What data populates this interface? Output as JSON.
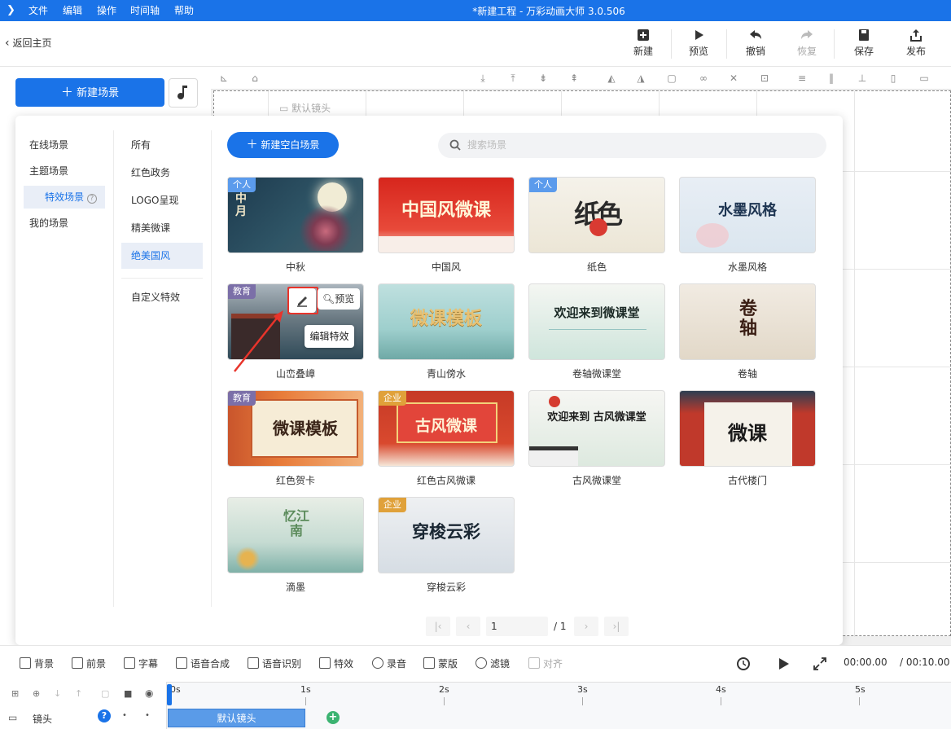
{
  "menubar": {
    "items": [
      "文件",
      "编辑",
      "操作",
      "时间轴",
      "帮助"
    ],
    "title": "*新建工程 - 万彩动画大师 3.0.506"
  },
  "toolbar": {
    "back": "返回主页",
    "buttons": [
      {
        "label": "新建",
        "icon": "plus-square-icon"
      },
      {
        "label": "预览",
        "icon": "play-icon"
      },
      {
        "label": "撤销",
        "icon": "undo-icon"
      },
      {
        "label": "恢复",
        "icon": "redo-icon",
        "disabled": true
      },
      {
        "label": "保存",
        "icon": "save-icon"
      },
      {
        "label": "发布",
        "icon": "publish-icon"
      }
    ]
  },
  "left": {
    "new_scene": "新建场景"
  },
  "canvas": {
    "default_shot": "默认镜头"
  },
  "panel": {
    "categories": [
      "在线场景",
      "主题场景",
      "特效场景",
      "我的场景"
    ],
    "selected_category": "特效场景",
    "subcategories": [
      "所有",
      "红色政务",
      "LOGO呈现",
      "精美微课",
      "绝美国风",
      "自定义特效"
    ],
    "selected_subcategory": "绝美国风",
    "new_blank": "新建空白场景",
    "search_placeholder": "搜索场景",
    "cards": [
      {
        "name": "中秋",
        "tag": "个人",
        "art": "中月"
      },
      {
        "name": "中国风",
        "tag": "",
        "art": "中国风微课"
      },
      {
        "name": "纸色",
        "tag": "个人",
        "art": "纸色"
      },
      {
        "name": "水墨风格",
        "tag": "",
        "art": "水墨风格"
      },
      {
        "name": "山峦叠嶂",
        "tag": "教育",
        "art": ""
      },
      {
        "name": "青山傍水",
        "tag": "",
        "art": "微课模板"
      },
      {
        "name": "卷轴微课堂",
        "tag": "",
        "art": "欢迎来到微课堂"
      },
      {
        "name": "卷轴",
        "tag": "",
        "art": "卷轴"
      },
      {
        "name": "红色贺卡",
        "tag": "教育",
        "art": "微课模板"
      },
      {
        "name": "红色古风微课",
        "tag": "企业",
        "art": "古风微课"
      },
      {
        "name": "古风微课堂",
        "tag": "",
        "art": "欢迎来到 古风微课堂"
      },
      {
        "name": "古代楼门",
        "tag": "",
        "art": "微课"
      },
      {
        "name": "滴墨",
        "tag": "",
        "art": "忆江南"
      },
      {
        "name": "穿梭云彩",
        "tag": "企业",
        "art": "穿梭云彩"
      }
    ],
    "hover": {
      "preview": "预览",
      "tooltip": "编辑特效"
    },
    "pagination": {
      "current": "1",
      "total": "/ 1"
    }
  },
  "bottombar": {
    "items": [
      "背景",
      "前景",
      "字幕",
      "语音合成",
      "语音识别",
      "特效",
      "录音",
      "蒙版",
      "滤镜",
      "对齐"
    ],
    "time_current": "00:00.00",
    "time_total": "/ 00:10.00"
  },
  "timeline": {
    "track": "镜头",
    "ticks": [
      "0s",
      "1s",
      "2s",
      "3s",
      "4s",
      "5s"
    ],
    "clip": "默认镜头"
  },
  "colors": {
    "accent": "#1a73e8",
    "tag_personal": "#5b9bec",
    "tag_edu": "#7b6fa8",
    "tag_company": "#e0a13a"
  }
}
